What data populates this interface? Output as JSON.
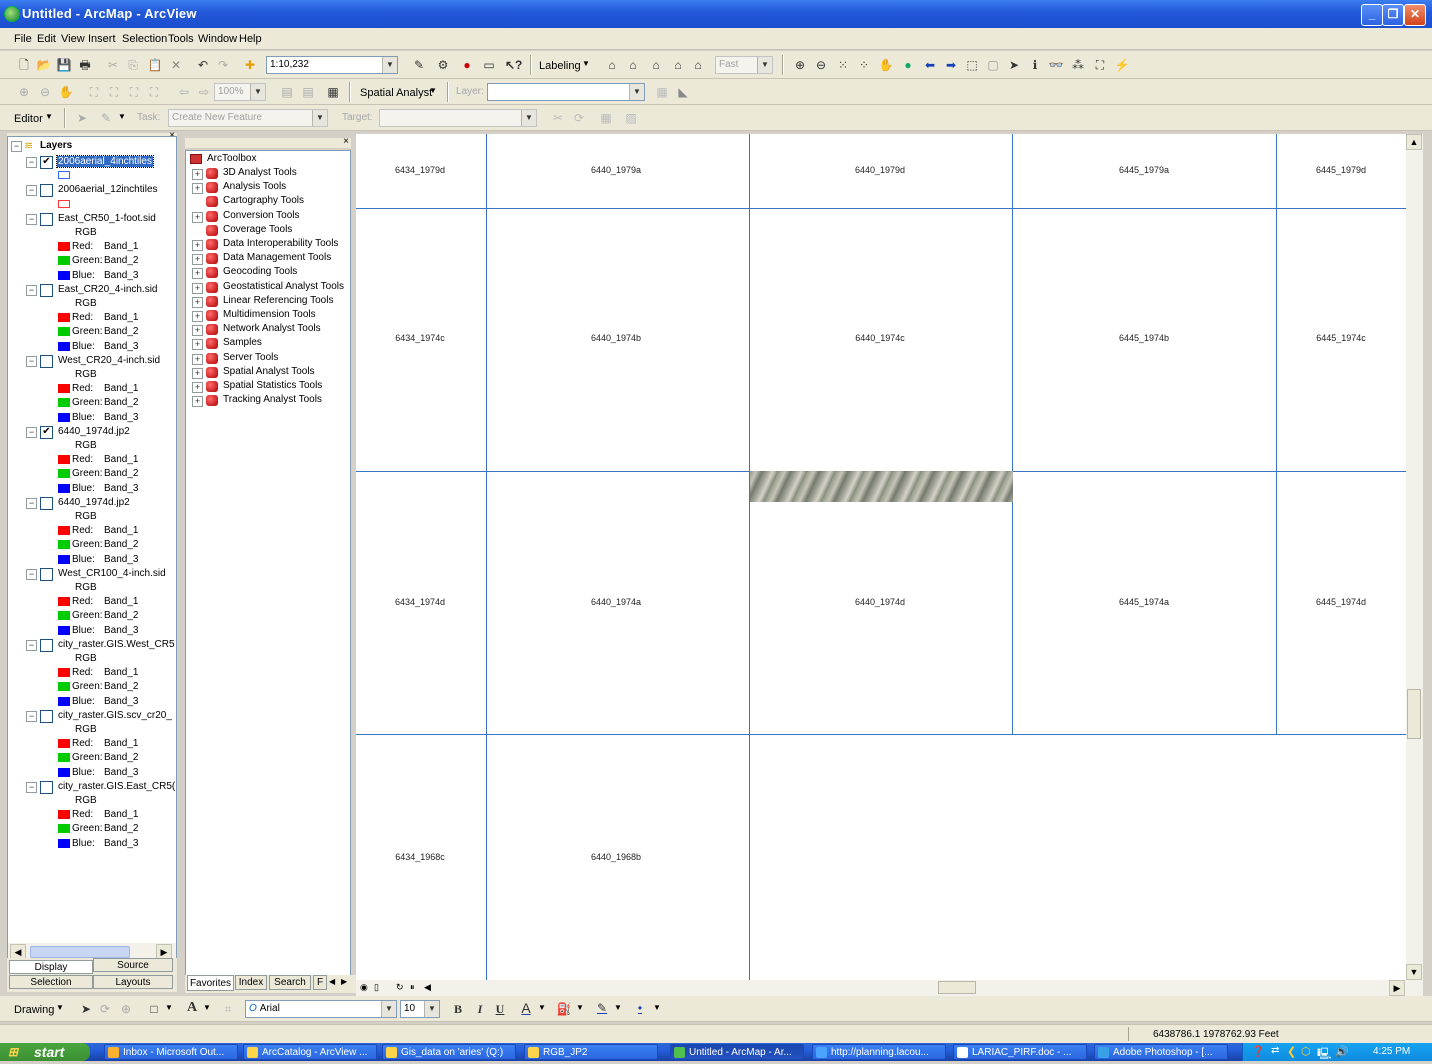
{
  "window": {
    "title": "Untitled - ArcMap - ArcView"
  },
  "menu": [
    "File",
    "Edit",
    "View",
    "Insert",
    "Selection",
    "Tools",
    "Window",
    "Help"
  ],
  "standard_toolbar": {
    "scale": "1:10,232",
    "labeling": "Labeling",
    "quality": "Fast"
  },
  "spatial_toolbar": {
    "zoom": "100%",
    "spatial_analyst": "Spatial Analyst",
    "layer_label": "Layer:"
  },
  "editor_toolbar": {
    "editor": "Editor",
    "task_label": "Task:",
    "task_value": "Create New Feature",
    "target_label": "Target:"
  },
  "toc": {
    "root": "Layers",
    "layers": [
      {
        "name": "2006aerial_4inchtiles",
        "checked": true,
        "selected": true,
        "symbol": "outline-blue"
      },
      {
        "name": "2006aerial_12inchtiles",
        "checked": false,
        "symbol": "outline-red"
      },
      {
        "name": "East_CR50_1-foot.sid",
        "checked": false,
        "rgb": true
      },
      {
        "name": "East_CR20_4-inch.sid",
        "checked": false,
        "rgb": true
      },
      {
        "name": "West_CR20_4-inch.sid",
        "checked": false,
        "rgb": true
      },
      {
        "name": "6440_1974d.jp2",
        "checked": true,
        "rgb": true
      },
      {
        "name": "6440_1974d.jp2",
        "checked": false,
        "rgb": true
      },
      {
        "name": "West_CR100_4-inch.sid",
        "checked": false,
        "rgb": true
      },
      {
        "name": "city_raster.GIS.West_CR5",
        "checked": false,
        "rgb": true
      },
      {
        "name": "city_raster.GIS.scv_cr20_",
        "checked": false,
        "rgb": true
      },
      {
        "name": "city_raster.GIS.East_CR5(",
        "checked": false,
        "rgb": true
      }
    ],
    "rgb_label": "RGB",
    "bands": [
      {
        "label": "Red:",
        "band": "Band_1",
        "color": "#ff0000"
      },
      {
        "label": "Green:",
        "band": "Band_2",
        "color": "#00cc00"
      },
      {
        "label": "Blue:",
        "band": "Band_3",
        "color": "#0000ff"
      }
    ],
    "tabs": {
      "display": "Display",
      "source": "Source",
      "selection": "Selection",
      "layouts": "Layouts"
    }
  },
  "toolbox": {
    "root": "ArcToolbox",
    "items": [
      "3D Analyst Tools",
      "Analysis Tools",
      "Cartography Tools",
      "Conversion Tools",
      "Coverage Tools",
      "Data Interoperability Tools",
      "Data Management Tools",
      "Geocoding Tools",
      "Geostatistical Analyst Tools",
      "Linear Referencing Tools",
      "Multidimension Tools",
      "Network Analyst Tools",
      "Samples",
      "Server Tools",
      "Spatial Analyst Tools",
      "Spatial Statistics Tools",
      "Tracking Analyst Tools"
    ],
    "tabs": [
      "Favorites",
      "Index",
      "Search",
      "F"
    ]
  },
  "map": {
    "tiles": [
      "6434_1979d",
      "6440_1979a",
      "6440_1979d",
      "6445_1979a",
      "6445_1979d",
      "6434_1974c",
      "6440_1974b",
      "6440_1974c",
      "6445_1974b",
      "6445_1974c",
      "6434_1974d",
      "6440_1974a",
      "6440_1974d",
      "6445_1974a",
      "6445_1974d",
      "6434_1968c",
      "6440_1968b"
    ]
  },
  "drawing_toolbar": {
    "drawing": "Drawing",
    "font": "Arial",
    "size": "10"
  },
  "status": {
    "coords": "6438786.1  1978762.93 Feet"
  },
  "taskbar": {
    "start": "start",
    "tasks": [
      "Inbox - Microsoft Out...",
      "ArcCatalog - ArcView ...",
      "Gis_data on 'aries' (Q:)",
      "RGB_JP2",
      "Untitled - ArcMap - Ar...",
      "http://planning.lacou...",
      "LARIAC_PIRF.doc - ...",
      "Adobe Photoshop - [..."
    ],
    "clock": "4:25 PM"
  }
}
